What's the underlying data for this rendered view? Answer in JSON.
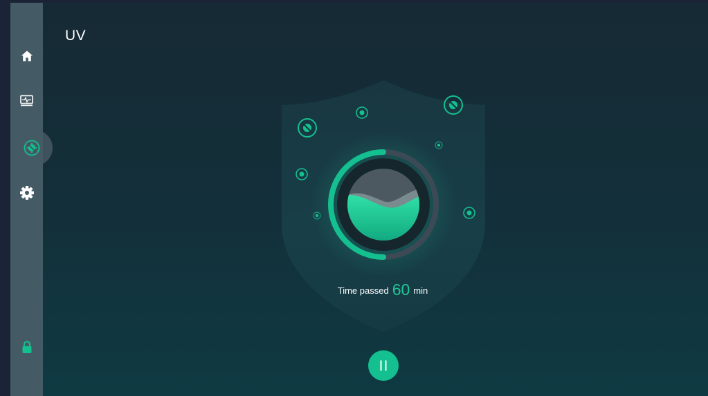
{
  "page": {
    "title": "UV"
  },
  "sidebar": {
    "items": [
      {
        "name": "home",
        "icon": "home-icon"
      },
      {
        "name": "monitor",
        "icon": "monitor-icon"
      },
      {
        "name": "uv-disinfection",
        "icon": "virus-icon",
        "active": true
      },
      {
        "name": "settings",
        "icon": "gear-icon"
      }
    ],
    "lock": {
      "icon": "lock-icon"
    }
  },
  "timer": {
    "prefix": "Time passed",
    "value": "60",
    "unit": "min",
    "progress": 0.5
  },
  "controls": {
    "pause_icon": "pause-icon"
  },
  "colors": {
    "accent": "#14c08f",
    "sidebar": "#445a64",
    "background": "#152b36",
    "text": "#ffffff"
  }
}
